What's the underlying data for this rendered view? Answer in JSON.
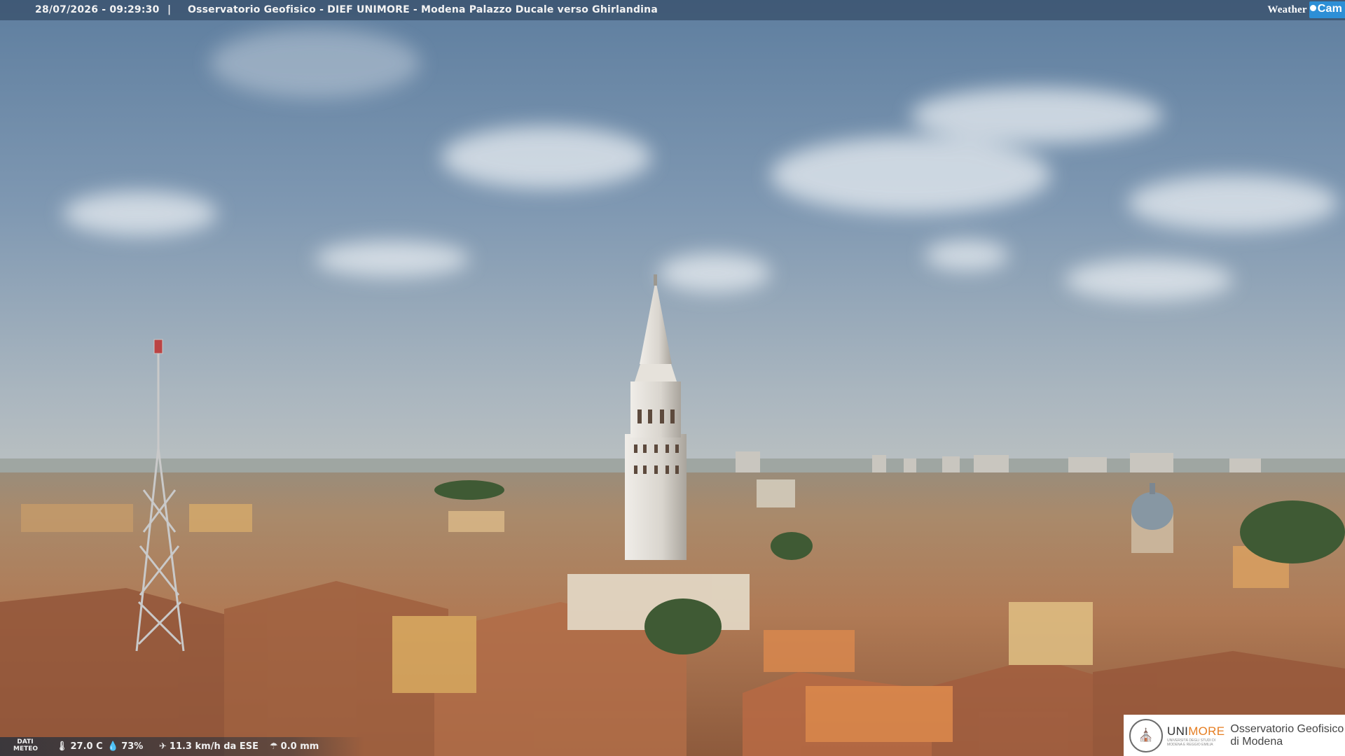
{
  "overlay": {
    "timestamp": "28/07/2026 - 09:29:30",
    "separator": "|",
    "title": "Osservatorio Geofisico - DIEF UNIMORE - Modena Palazzo Ducale verso Ghirlandina",
    "brand_weather": "Weather",
    "brand_cam": "Cam"
  },
  "meteo": {
    "label_line1": "DATI",
    "label_line2": "METEO",
    "temperature": "27.0 C",
    "humidity": "73%",
    "wind": "11.3 km/h da ESE",
    "rain": "0.0 mm",
    "icons": [
      "thermometer-icon",
      "humidity-drop-icon",
      "wind-icon",
      "rain-icon"
    ]
  },
  "logo": {
    "uni_prefix": "UNI",
    "uni_suffix": "MORE",
    "uni_sub_1": "UNIVERSITÀ DEGLI STUDI DI",
    "uni_sub_2": "MODENA E REGGIO EMILIA",
    "obs_line1": "Osservatorio Geofisico",
    "obs_line2": "di Modena"
  },
  "colors": {
    "sky_top": "#5f7fa0",
    "sky_bottom": "#b9c3c9",
    "roofs": "#a86a47",
    "tower": "#dcd8d1",
    "accent_orange": "#e67e22",
    "brand_blue": "#2d8fd6"
  }
}
